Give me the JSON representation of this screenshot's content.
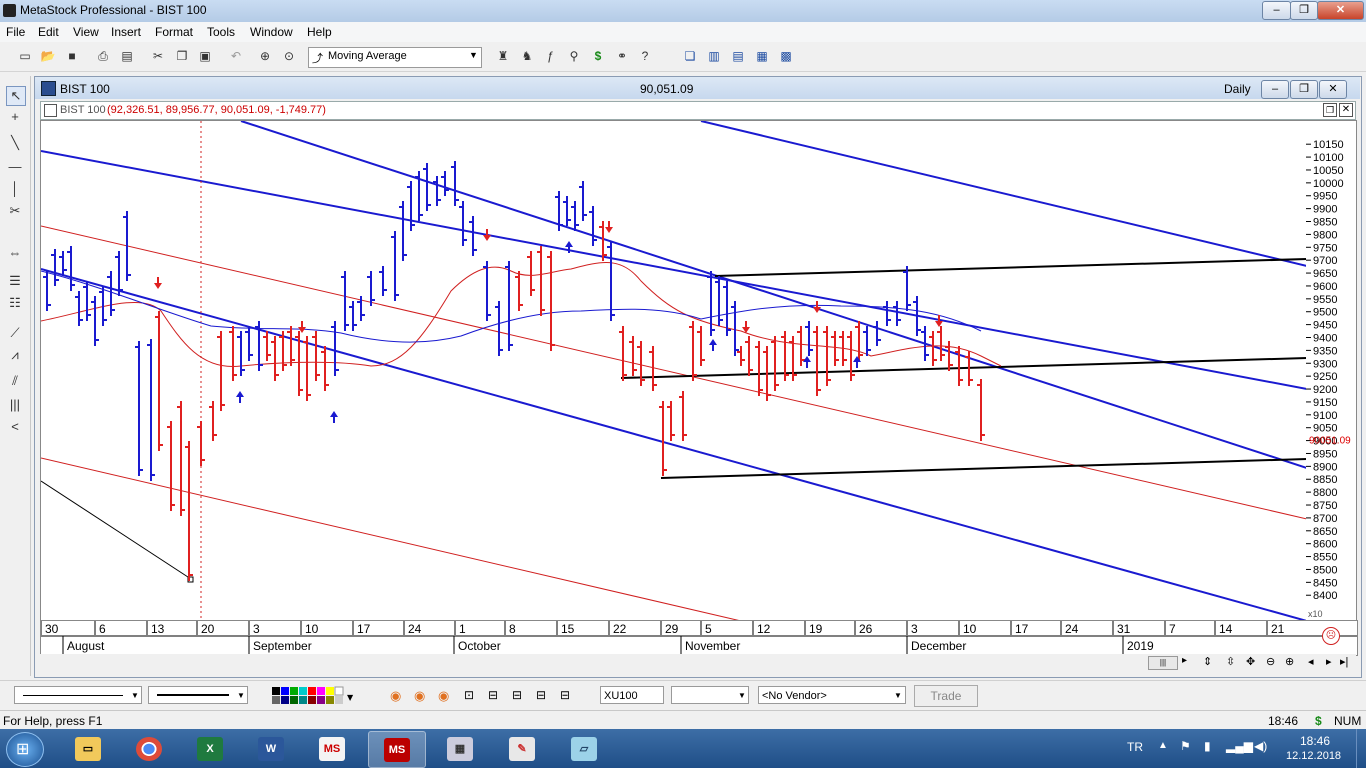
{
  "app": {
    "title": "MetaStock Professional - BIST 100",
    "window_buttons": [
      "–",
      "❐",
      "✕"
    ]
  },
  "menu": [
    "File",
    "Edit",
    "View",
    "Insert",
    "Format",
    "Tools",
    "Window",
    "Help"
  ],
  "toolbar": {
    "indicator_select": "Moving Average",
    "icons": [
      "new-icon",
      "open-icon",
      "save-icon",
      "print-icon",
      "print-preview-icon",
      "cut-icon",
      "copy-icon",
      "paste-icon",
      "undo-icon",
      "crosshair-icon",
      "zoom-icon"
    ]
  },
  "chart_window": {
    "symbol": "BIST 100",
    "last_value": "90,051.09",
    "periodicity": "Daily",
    "inner_title": "BIST 100",
    "ohlc_text": "(92,326.51, 89,956.77, 90,051.09, -1,749.77)",
    "price_tag": "90051.09",
    "multiplier": "x10"
  },
  "chart_data": {
    "type": "bar",
    "ylim": [
      8300,
      10240
    ],
    "y_ticks": [
      "10150",
      "10100",
      "10050",
      "10000",
      "9950",
      "9900",
      "9850",
      "9800",
      "9750",
      "9700",
      "9650",
      "9600",
      "9550",
      "9500",
      "9450",
      "9400",
      "9350",
      "9300",
      "9250",
      "9200",
      "9150",
      "9100",
      "9050",
      "9000",
      "8950",
      "8900",
      "8850",
      "8800",
      "8750",
      "8700",
      "8650",
      "8600",
      "8550",
      "8500",
      "8450",
      "8400"
    ],
    "x_day_labels": [
      "30",
      "6",
      "13",
      "20",
      "3",
      "10",
      "17",
      "24",
      "1",
      "8",
      "15",
      "22",
      "29",
      "5",
      "12",
      "19",
      "26",
      "3",
      "10",
      "17",
      "24",
      "31",
      "7",
      "14",
      "21"
    ],
    "x_month_labels": [
      "August",
      "September",
      "October",
      "November",
      "December",
      "2019"
    ],
    "last_close": 9005.109
  },
  "bottom_toolbar": {
    "symbol_field": "XU100",
    "vendor_select": "<No Vendor>",
    "trade_button": "Trade"
  },
  "status": {
    "help_text": "For Help, press F1",
    "time": "18:46",
    "currency": "$",
    "num": "NUM"
  },
  "taskbar": {
    "language": "TR",
    "clock_time": "18:46",
    "clock_date": "12.12.2018",
    "apps": [
      "explorer",
      "chrome",
      "excel",
      "word",
      "metastock-downloader",
      "metastock",
      "calculator",
      "paint",
      "notes"
    ]
  }
}
